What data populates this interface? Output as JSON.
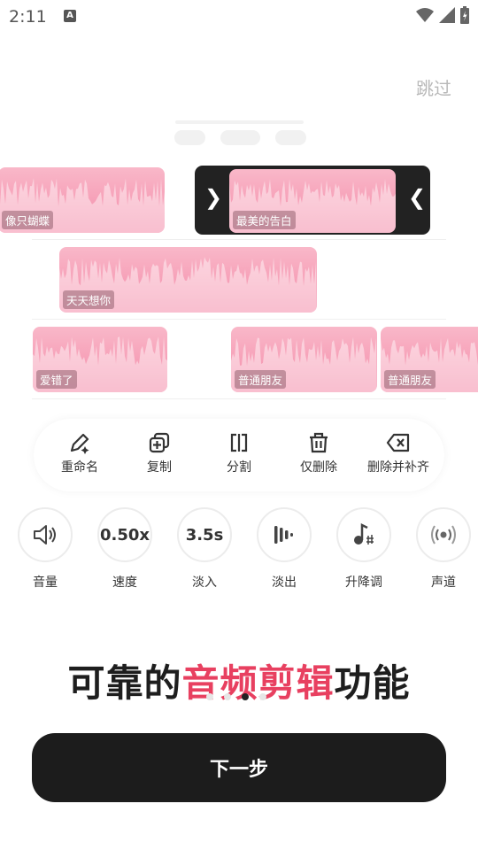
{
  "status": {
    "time": "2:11",
    "notif_icon": "A"
  },
  "skip_label": "跳过",
  "clips": [
    {
      "label": "像只蝴蝶"
    },
    {
      "label": "最美的告白"
    },
    {
      "label": "天天想你"
    },
    {
      "label": "爱错了"
    },
    {
      "label": "普通朋友"
    },
    {
      "label": "普通朋友"
    }
  ],
  "toolbar": [
    {
      "icon": "rename-pen-icon",
      "label": "重命名"
    },
    {
      "icon": "copy-icon",
      "label": "复制"
    },
    {
      "icon": "split-icon",
      "label": "分割"
    },
    {
      "icon": "trash-icon",
      "label": "仅删除"
    },
    {
      "icon": "delete-backspace-icon",
      "label": "删除并补齐"
    }
  ],
  "controls": [
    {
      "icon": "volume-icon",
      "value": "",
      "label": "音量"
    },
    {
      "icon": "",
      "value": "0.50x",
      "label": "速度"
    },
    {
      "icon": "",
      "value": "3.5s",
      "label": "淡入"
    },
    {
      "icon": "fade-out-bars-icon",
      "value": "",
      "label": "淡出"
    },
    {
      "icon": "music-note-sharp-icon",
      "value": "",
      "label": "升降调"
    },
    {
      "icon": "channel-icon",
      "value": "",
      "label": "声道"
    }
  ],
  "headline": {
    "part1": "可靠的",
    "highlight": "音频剪辑",
    "part2": "功能"
  },
  "pager": {
    "count": 4,
    "active": 2
  },
  "next_label": "下一步",
  "colors": {
    "accent": "#e84060",
    "clip_pink": "#f48aa8",
    "dark": "#1c1c1c"
  }
}
